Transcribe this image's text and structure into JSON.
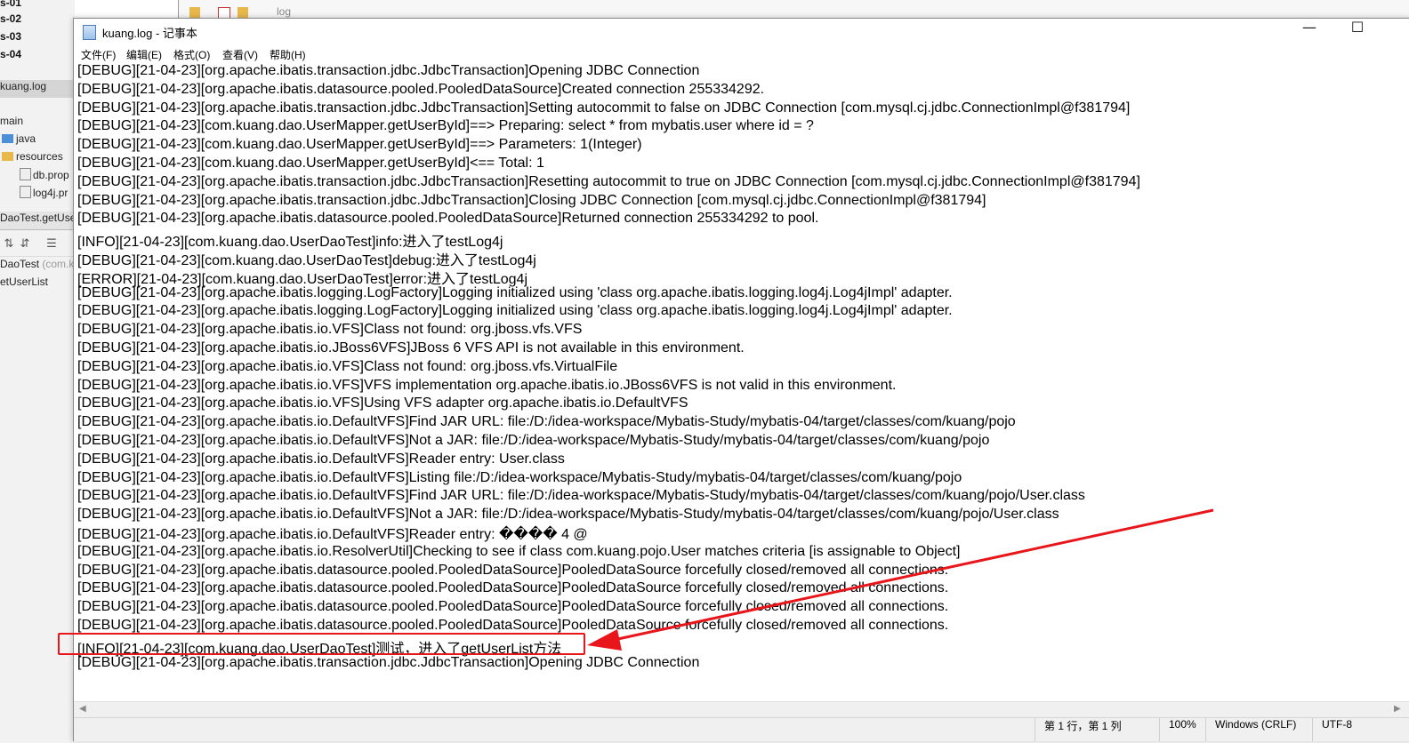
{
  "ide": {
    "run_configs": [
      "s-01",
      "s-02",
      "s-03",
      "s-04"
    ],
    "selected_file": "kuang.log",
    "tree": {
      "main": "main",
      "java": "java",
      "resources": "resources",
      "db_props": "db.prop",
      "log4j_props": "log4j.pr"
    },
    "editor_tab": "DaoTest.getUse",
    "structure": {
      "class": "DaoTest",
      "class_hint": "(com.k",
      "method": "etUserList"
    },
    "search_placeholder": "log"
  },
  "notepad": {
    "title": "kuang.log - 记事本",
    "window_controls": {
      "minimize": "—",
      "maximize": "☐"
    },
    "menu": [
      "文件(F)",
      "编辑(E)",
      "格式(O)",
      "查看(V)",
      "帮助(H)"
    ],
    "lines": [
      "[DEBUG][21-04-23][org.apache.ibatis.transaction.jdbc.JdbcTransaction]Opening JDBC Connection",
      "[DEBUG][21-04-23][org.apache.ibatis.datasource.pooled.PooledDataSource]Created connection 255334292.",
      "[DEBUG][21-04-23][org.apache.ibatis.transaction.jdbc.JdbcTransaction]Setting autocommit to false on JDBC Connection [com.mysql.cj.jdbc.ConnectionImpl@f381794]",
      "[DEBUG][21-04-23][com.kuang.dao.UserMapper.getUserById]==>  Preparing: select * from mybatis.user where id = ?",
      "[DEBUG][21-04-23][com.kuang.dao.UserMapper.getUserById]==> Parameters: 1(Integer)",
      "[DEBUG][21-04-23][com.kuang.dao.UserMapper.getUserById]<==      Total: 1",
      "[DEBUG][21-04-23][org.apache.ibatis.transaction.jdbc.JdbcTransaction]Resetting autocommit to true on JDBC Connection [com.mysql.cj.jdbc.ConnectionImpl@f381794]",
      "[DEBUG][21-04-23][org.apache.ibatis.transaction.jdbc.JdbcTransaction]Closing JDBC Connection [com.mysql.cj.jdbc.ConnectionImpl@f381794]",
      "[DEBUG][21-04-23][org.apache.ibatis.datasource.pooled.PooledDataSource]Returned connection 255334292 to pool.",
      "[INFO][21-04-23][com.kuang.dao.UserDaoTest]info:进入了testLog4j",
      "[DEBUG][21-04-23][com.kuang.dao.UserDaoTest]debug:进入了testLog4j",
      "[ERROR][21-04-23][com.kuang.dao.UserDaoTest]error:进入了testLog4j",
      "[DEBUG][21-04-23][org.apache.ibatis.logging.LogFactory]Logging initialized using 'class org.apache.ibatis.logging.log4j.Log4jImpl' adapter.",
      "[DEBUG][21-04-23][org.apache.ibatis.logging.LogFactory]Logging initialized using 'class org.apache.ibatis.logging.log4j.Log4jImpl' adapter.",
      "[DEBUG][21-04-23][org.apache.ibatis.io.VFS]Class not found: org.jboss.vfs.VFS",
      "[DEBUG][21-04-23][org.apache.ibatis.io.JBoss6VFS]JBoss 6 VFS API is not available in this environment.",
      "[DEBUG][21-04-23][org.apache.ibatis.io.VFS]Class not found: org.jboss.vfs.VirtualFile",
      "[DEBUG][21-04-23][org.apache.ibatis.io.VFS]VFS implementation org.apache.ibatis.io.JBoss6VFS is not valid in this environment.",
      "[DEBUG][21-04-23][org.apache.ibatis.io.VFS]Using VFS adapter org.apache.ibatis.io.DefaultVFS",
      "[DEBUG][21-04-23][org.apache.ibatis.io.DefaultVFS]Find JAR URL: file:/D:/idea-workspace/Mybatis-Study/mybatis-04/target/classes/com/kuang/pojo",
      "[DEBUG][21-04-23][org.apache.ibatis.io.DefaultVFS]Not a JAR: file:/D:/idea-workspace/Mybatis-Study/mybatis-04/target/classes/com/kuang/pojo",
      "[DEBUG][21-04-23][org.apache.ibatis.io.DefaultVFS]Reader entry: User.class",
      "[DEBUG][21-04-23][org.apache.ibatis.io.DefaultVFS]Listing file:/D:/idea-workspace/Mybatis-Study/mybatis-04/target/classes/com/kuang/pojo",
      "[DEBUG][21-04-23][org.apache.ibatis.io.DefaultVFS]Find JAR URL: file:/D:/idea-workspace/Mybatis-Study/mybatis-04/target/classes/com/kuang/pojo/User.class",
      "[DEBUG][21-04-23][org.apache.ibatis.io.DefaultVFS]Not a JAR: file:/D:/idea-workspace/Mybatis-Study/mybatis-04/target/classes/com/kuang/pojo/User.class",
      "[DEBUG][21-04-23][org.apache.ibatis.io.DefaultVFS]Reader entry: ����    4 @",
      "[DEBUG][21-04-23][org.apache.ibatis.io.ResolverUtil]Checking to see if class com.kuang.pojo.User matches criteria [is assignable to Object]",
      "[DEBUG][21-04-23][org.apache.ibatis.datasource.pooled.PooledDataSource]PooledDataSource forcefully closed/removed all connections.",
      "[DEBUG][21-04-23][org.apache.ibatis.datasource.pooled.PooledDataSource]PooledDataSource forcefully closed/removed all connections.",
      "[DEBUG][21-04-23][org.apache.ibatis.datasource.pooled.PooledDataSource]PooledDataSource forcefully closed/removed all connections.",
      "[DEBUG][21-04-23][org.apache.ibatis.datasource.pooled.PooledDataSource]PooledDataSource forcefully closed/removed all connections.",
      "[INFO][21-04-23][com.kuang.dao.UserDaoTest]测试，进入了getUserList方法",
      "[DEBUG][21-04-23][org.apache.ibatis.transaction.jdbc.JdbcTransaction]Opening JDBC Connection"
    ],
    "highlighted_line_index": 31,
    "status": {
      "position": "第 1 行，第 1 列",
      "zoom": "100%",
      "line_ending": "Windows (CRLF)",
      "encoding": "UTF-8"
    }
  },
  "colors": {
    "annotation": "#e8161b",
    "folder": "#e8b84a",
    "java_folder": "#4a8fd8"
  }
}
